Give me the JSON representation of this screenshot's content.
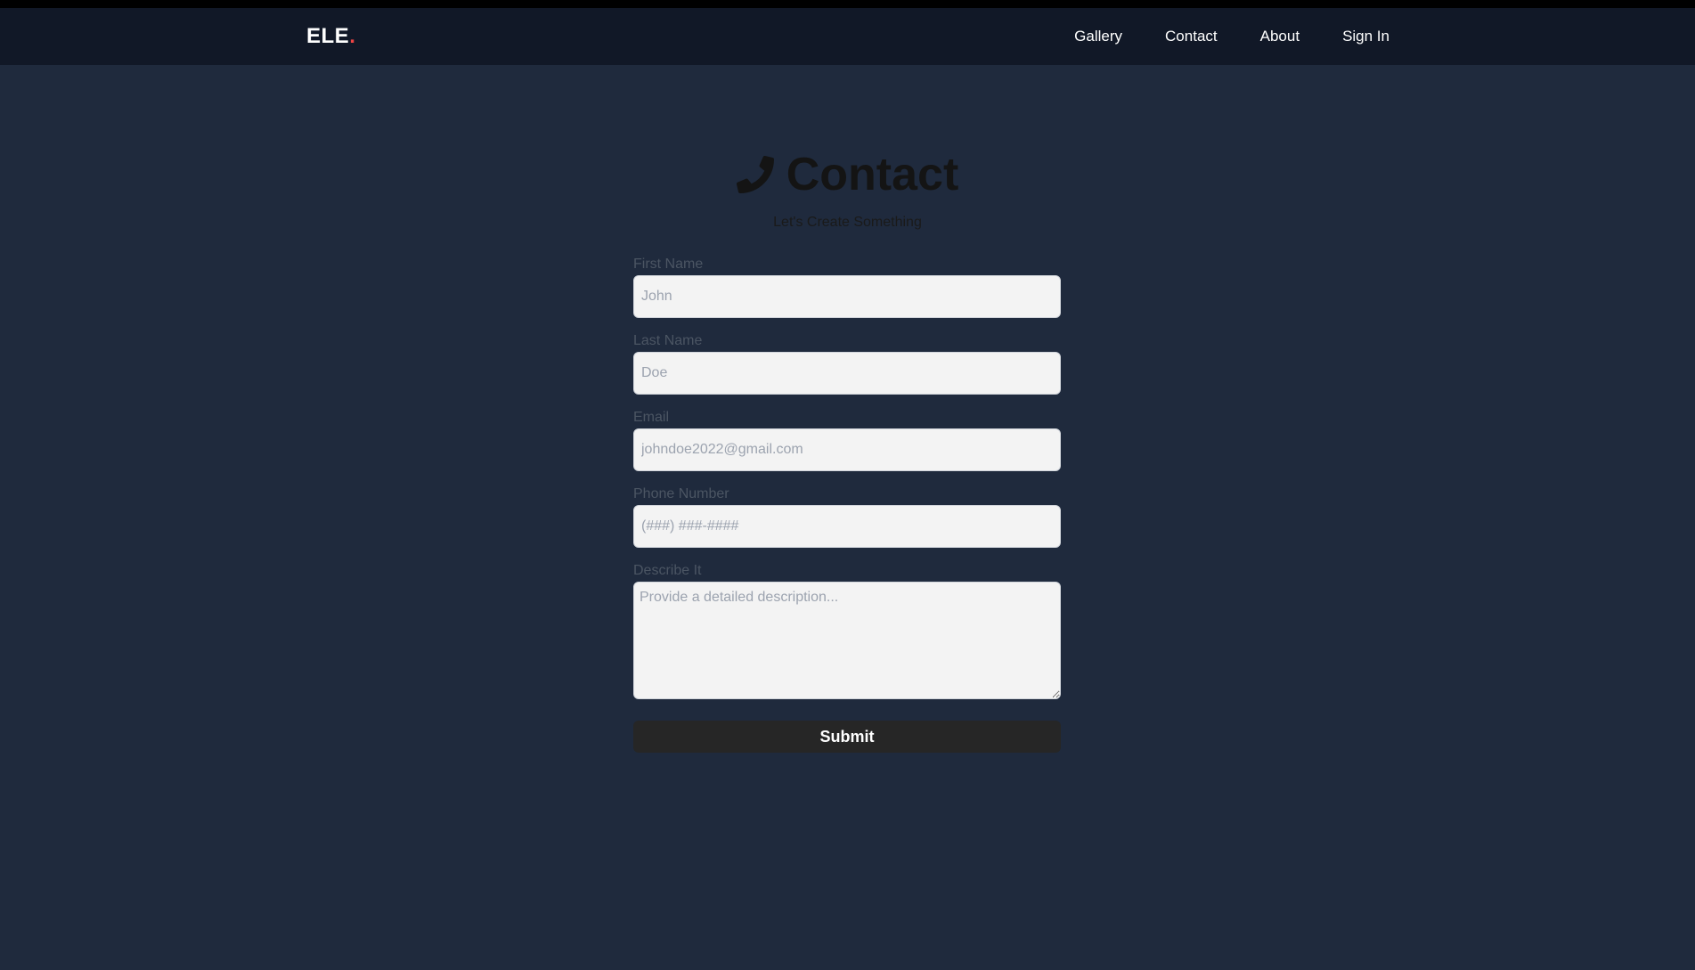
{
  "brand": {
    "name": "ELE",
    "dot": ".",
    "dot_color": "#ef4444"
  },
  "nav": {
    "items": [
      {
        "label": "Gallery"
      },
      {
        "label": "Contact"
      },
      {
        "label": "About"
      },
      {
        "label": "Sign In"
      }
    ]
  },
  "header": {
    "icon": "phone-icon",
    "title": "Contact",
    "subtitle": "Let's Create Something"
  },
  "form": {
    "first_name": {
      "label": "First Name",
      "placeholder": "John",
      "value": ""
    },
    "last_name": {
      "label": "Last Name",
      "placeholder": "Doe",
      "value": ""
    },
    "email": {
      "label": "Email",
      "placeholder": "johndoe2022@gmail.com",
      "value": ""
    },
    "phone": {
      "label": "Phone Number",
      "placeholder": "(###) ###-####",
      "value": ""
    },
    "description": {
      "label": "Describe It",
      "placeholder": "Provide a detailed description...",
      "value": ""
    },
    "submit_label": "Submit"
  },
  "colors": {
    "page_background": "#1f2a3d",
    "navbar_background": "#111827",
    "button_background": "#262626",
    "input_background": "#f3f3f3"
  }
}
